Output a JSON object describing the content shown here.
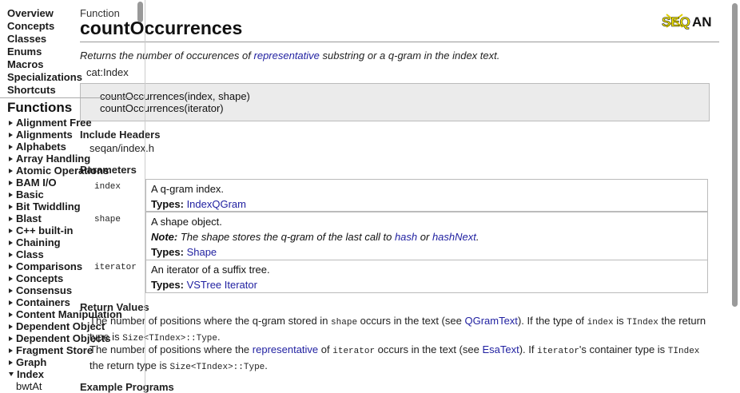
{
  "page": {
    "type_label": "Function",
    "title": "countOccurrences",
    "summary_prefix": "Returns the number of occurences of ",
    "summary_link": "representative",
    "summary_suffix": " substring or a q-gram in the index text.",
    "category": "cat:Index",
    "signatures": [
      "countOccurrences(index, shape)",
      "countOccurrences(iterator)"
    ],
    "include_heading": "Include Headers",
    "include_value": "seqan/index.h",
    "params_heading": "Parameters",
    "types_label": "Types:",
    "note_label": "Note:",
    "params": [
      {
        "name": "index",
        "desc": "A q-gram index.",
        "types": "IndexQGram"
      },
      {
        "name": "shape",
        "desc": "A shape object.",
        "note_prefix": "The shape stores the q-gram of the last call to ",
        "note_link1": "hash",
        "note_mid": " or ",
        "note_link2": "hashNext",
        "note_suffix": ".",
        "types": "Shape"
      },
      {
        "name": "iterator",
        "desc": "An iterator of a suffix tree.",
        "types": "VSTree Iterator"
      }
    ],
    "returns_heading": "Return Values",
    "returns": [
      {
        "t1": "The number of positions where the q-gram stored in ",
        "c1": "shape",
        "t2": " occurs in the text (see ",
        "link": "QGramText",
        "t3": "). If the type of ",
        "c2": "index",
        "t4": " is ",
        "c3": "TIndex",
        "t5": " the return type is ",
        "c4": "Size<TIndex>::Type",
        "t6": "."
      },
      {
        "t1": "The number of positions where the ",
        "link1": "representative",
        "t2": " of ",
        "c1": "iterator",
        "t3": " occurs in the text (see ",
        "link2": "EsaText",
        "t4": "). If ",
        "c2": "iterator",
        "t5": "'s container type is ",
        "c3": "TIndex",
        "t6": " the return type is ",
        "c4": "Size<TIndex>::Type",
        "t7": "."
      }
    ],
    "examples_heading": "Example Programs",
    "logo_text": "SEQAN"
  },
  "sidebar": {
    "nav": [
      "Overview",
      "Concepts",
      "Classes",
      "Enums",
      "Macros",
      "Specializations",
      "Shortcuts"
    ],
    "functions_heading": "Functions",
    "functions": [
      "Alignment Free",
      "Alignments",
      "Alphabets",
      "Array Handling",
      "Atomic Operations",
      "BAM I/O",
      "Basic",
      "Bit Twiddling",
      "Blast",
      "C++ built-in",
      "Chaining",
      "Class",
      "Comparisons",
      "Concepts",
      "Consensus",
      "Containers",
      "Content Manipulation",
      "Dependent Object",
      "Dependent Objects",
      "Fragment Store",
      "Graph",
      "Index"
    ],
    "open_sub": "bwtAt"
  },
  "colors": {
    "link": "#1f1fa0",
    "sig_bg": "#ebebeb",
    "logo_yellow": "#f2e600"
  }
}
